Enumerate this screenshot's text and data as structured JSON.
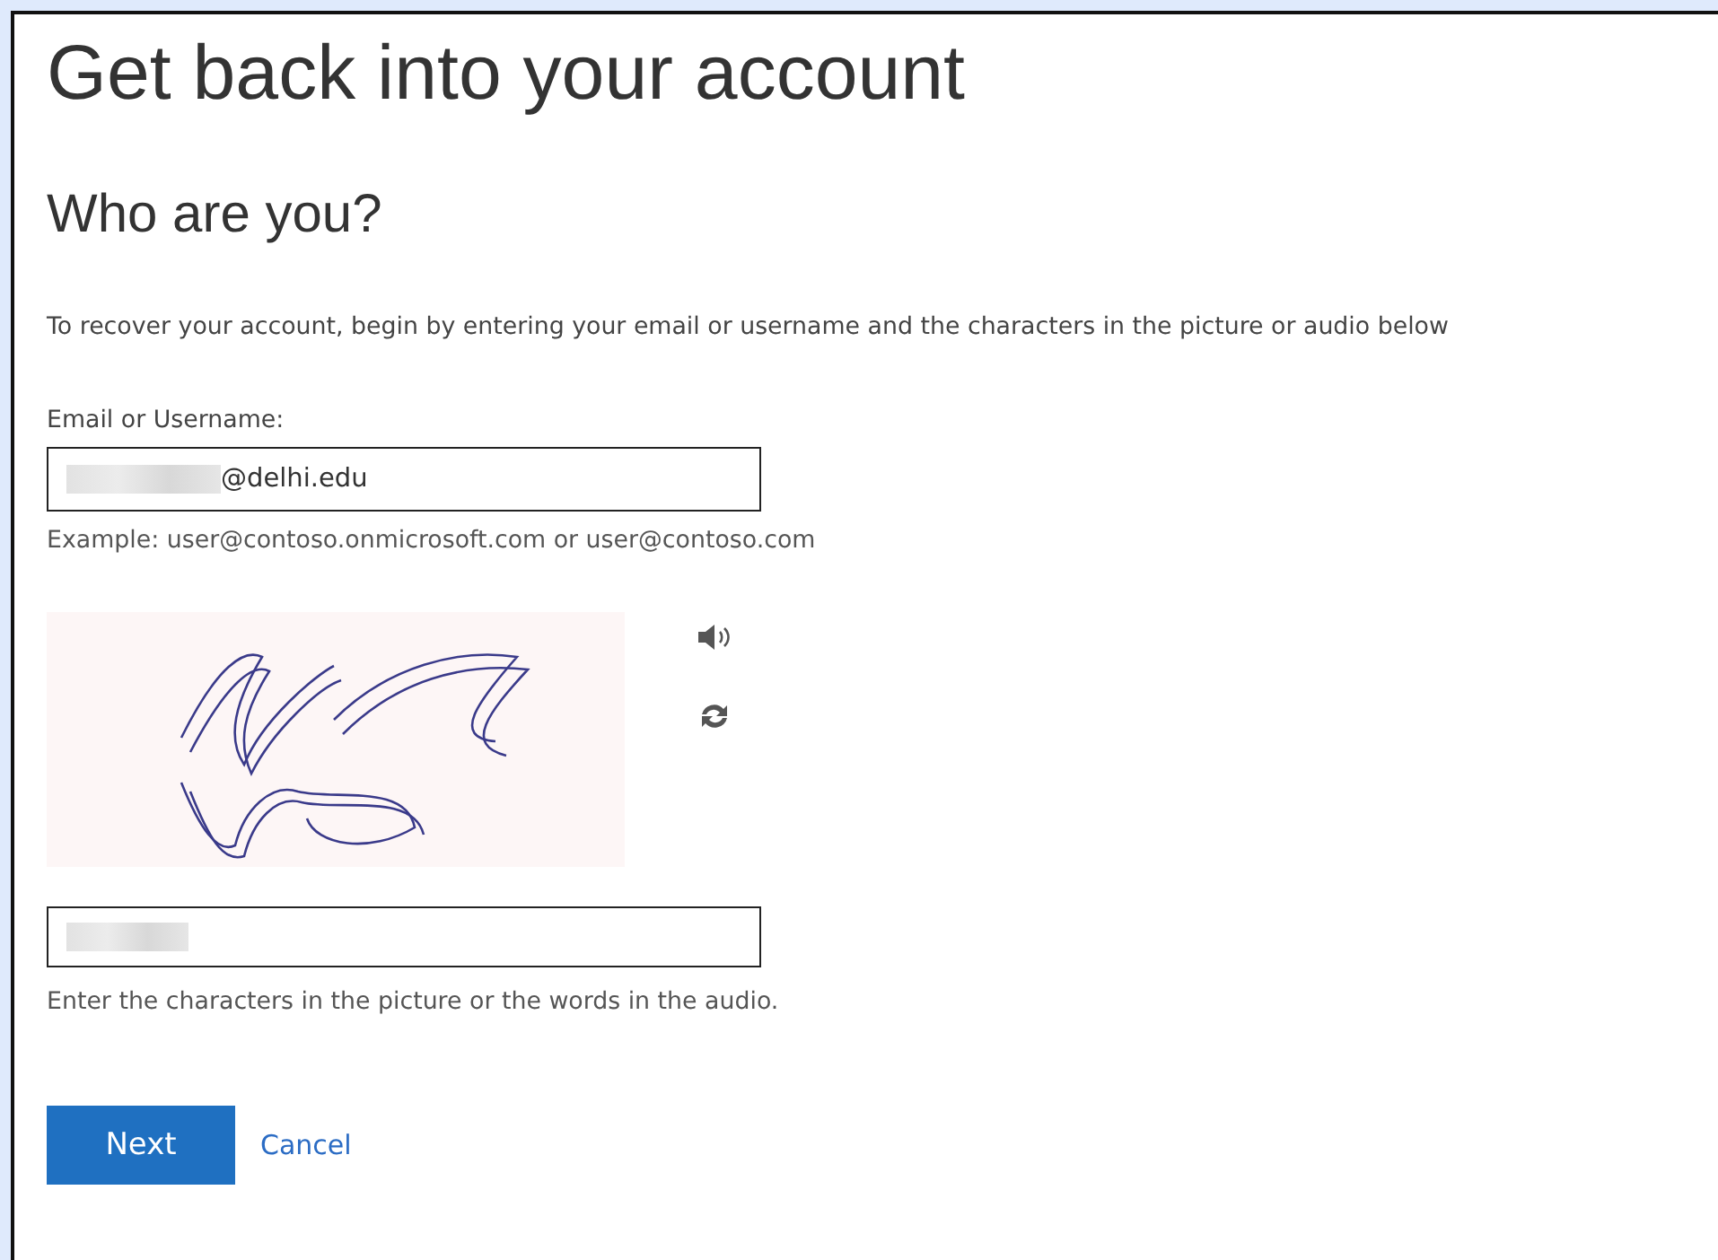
{
  "title": "Get back into your account",
  "subtitle": "Who are you?",
  "intro": "To recover your account, begin by entering your email or username and the characters in the picture or audio below",
  "email_field": {
    "label": "Email or Username:",
    "value": "@delhi.edu",
    "hint": "Example: user@contoso.onmicrosoft.com or user@contoso.com"
  },
  "captcha_field": {
    "hint": "Enter the characters in the picture or the words in the audio."
  },
  "buttons": {
    "next": "Next",
    "cancel": "Cancel"
  }
}
